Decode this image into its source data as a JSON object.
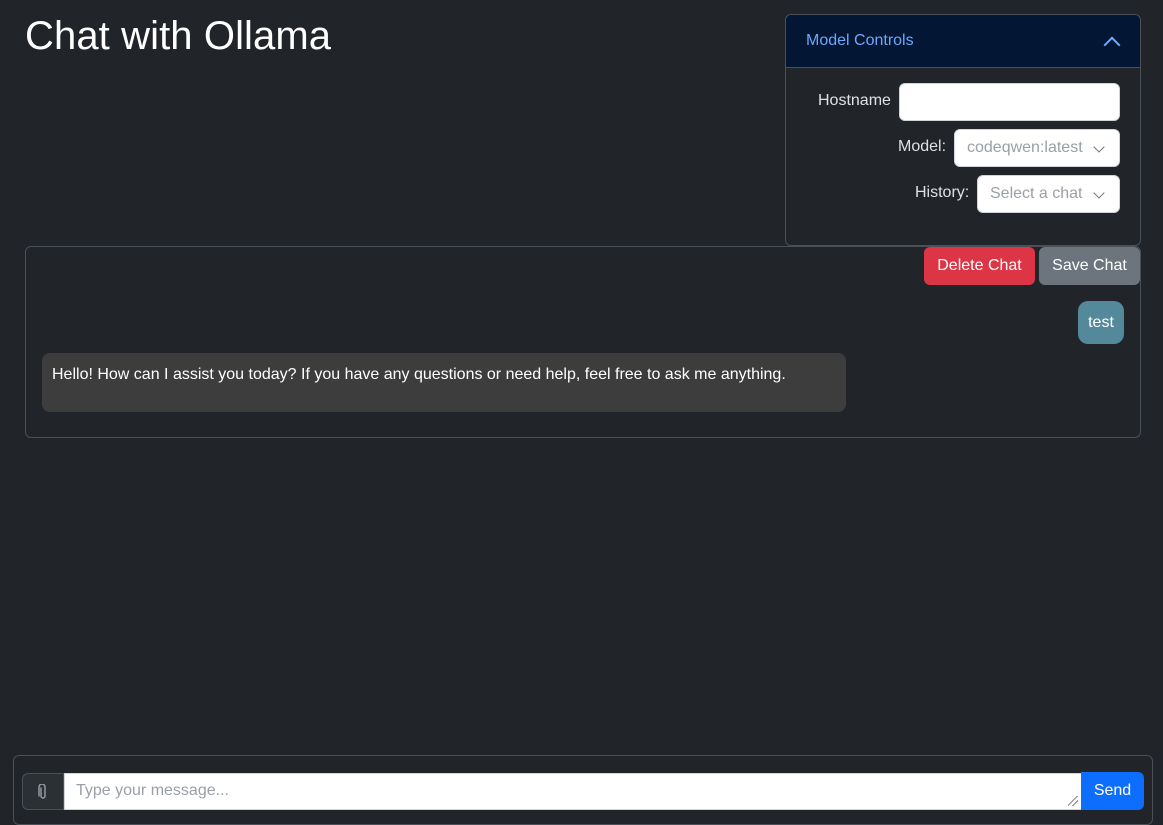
{
  "header": {
    "title": "Chat with Ollama"
  },
  "controls": {
    "title": "Model Controls",
    "hostname_label": "Hostname",
    "hostname_value": "",
    "model_label": "Model:",
    "model_selected": "codeqwen:latest",
    "history_label": "History:",
    "history_selected": "Select a chat"
  },
  "chat": {
    "delete_label": "Delete Chat",
    "save_label": "Save Chat",
    "messages": [
      {
        "role": "user",
        "text": "test"
      },
      {
        "role": "assistant",
        "text": "Hello! How can I assist you today? If you have any questions or need help, feel free to ask me anything."
      }
    ]
  },
  "composer": {
    "placeholder": "Type your message...",
    "send_label": "Send",
    "attach_icon": "paperclip-icon"
  },
  "colors": {
    "background": "#212529",
    "accent": "#6ea8fe",
    "danger": "#dc3545",
    "secondary": "#6c757d",
    "primary": "#0d6efd",
    "user_bubble": "#54899c",
    "assistant_bubble": "#3d3d3d"
  }
}
